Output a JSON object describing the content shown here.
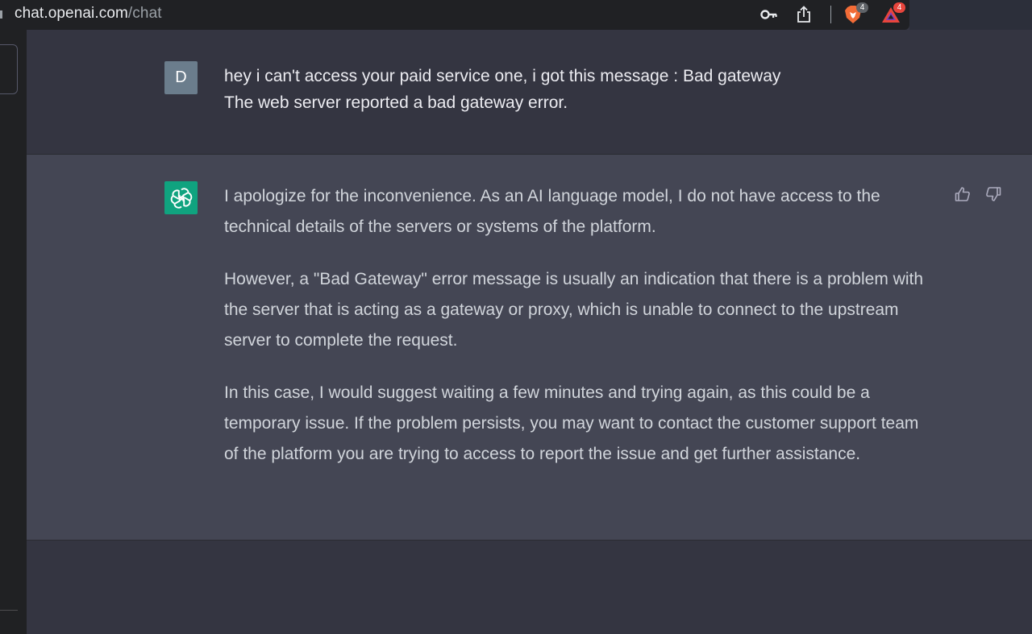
{
  "browser": {
    "url_host": "chat.openai.com",
    "url_path": "/chat",
    "brave_badge_count": "4",
    "rewards_badge_count": "4"
  },
  "user_message": {
    "avatar_letter": "D",
    "lines": [
      "hey i can't access your paid service one, i got this message : Bad gateway",
      "The web server reported a bad gateway error."
    ]
  },
  "assistant_message": {
    "paragraphs": [
      "I apologize for the inconvenience. As an AI language model, I do not have access to the technical details of the servers or systems of the platform.",
      "However, a \"Bad Gateway\" error message is usually an indication that there is a problem with the server that is acting as a gateway or proxy, which is unable to connect to the upstream server to complete the request.",
      "In this case, I would suggest waiting a few minutes and trying again, as this could be a temporary issue. If the problem persists, you may want to contact the customer support team of the platform you are trying to access to report the issue and get further assistance."
    ]
  },
  "colors": {
    "assistant_avatar_bg": "#10a37f",
    "user_avatar_bg": "#6b7d8c",
    "assistant_row_bg": "#444654",
    "user_row_bg": "#343541",
    "brave_badge": "#5f6368",
    "rewards_badge": "#e8453c"
  },
  "icons": {
    "password": "key-icon",
    "share": "share-icon",
    "brave_shields": "brave-lion-icon",
    "brave_rewards": "brave-rewards-triangle-icon",
    "assistant_avatar": "openai-logo-icon",
    "thumbs_up": "thumbs-up-icon",
    "thumbs_down": "thumbs-down-icon"
  }
}
